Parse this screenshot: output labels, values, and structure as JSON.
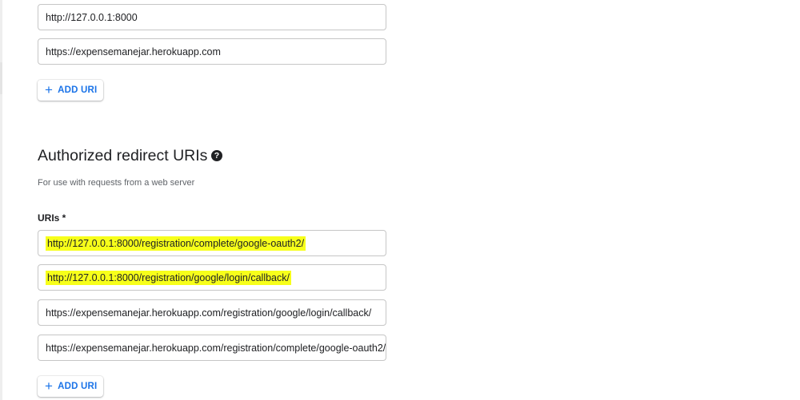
{
  "origins": {
    "uris": [
      "http://127.0.0.1:8000",
      "https://expensemanejar.herokuapp.com"
    ],
    "add_button": "ADD URI"
  },
  "redirect": {
    "title": "Authorized redirect URIs",
    "help_icon": "help-circle-icon",
    "description": "For use with requests from a web server",
    "field_label": "URIs *",
    "uris": [
      "http://127.0.0.1:8000/registration/complete/google-oauth2/",
      "http://127.0.0.1:8000/registration/google/login/callback/",
      "https://expensemanejar.herokuapp.com/registration/google/login/callback/",
      "https://expensemanejar.herokuapp.com/registration/complete/google-oauth2/"
    ],
    "add_button": "ADD URI"
  },
  "colors": {
    "highlight": "#f7ff1a",
    "accent": "#1a73e8"
  }
}
